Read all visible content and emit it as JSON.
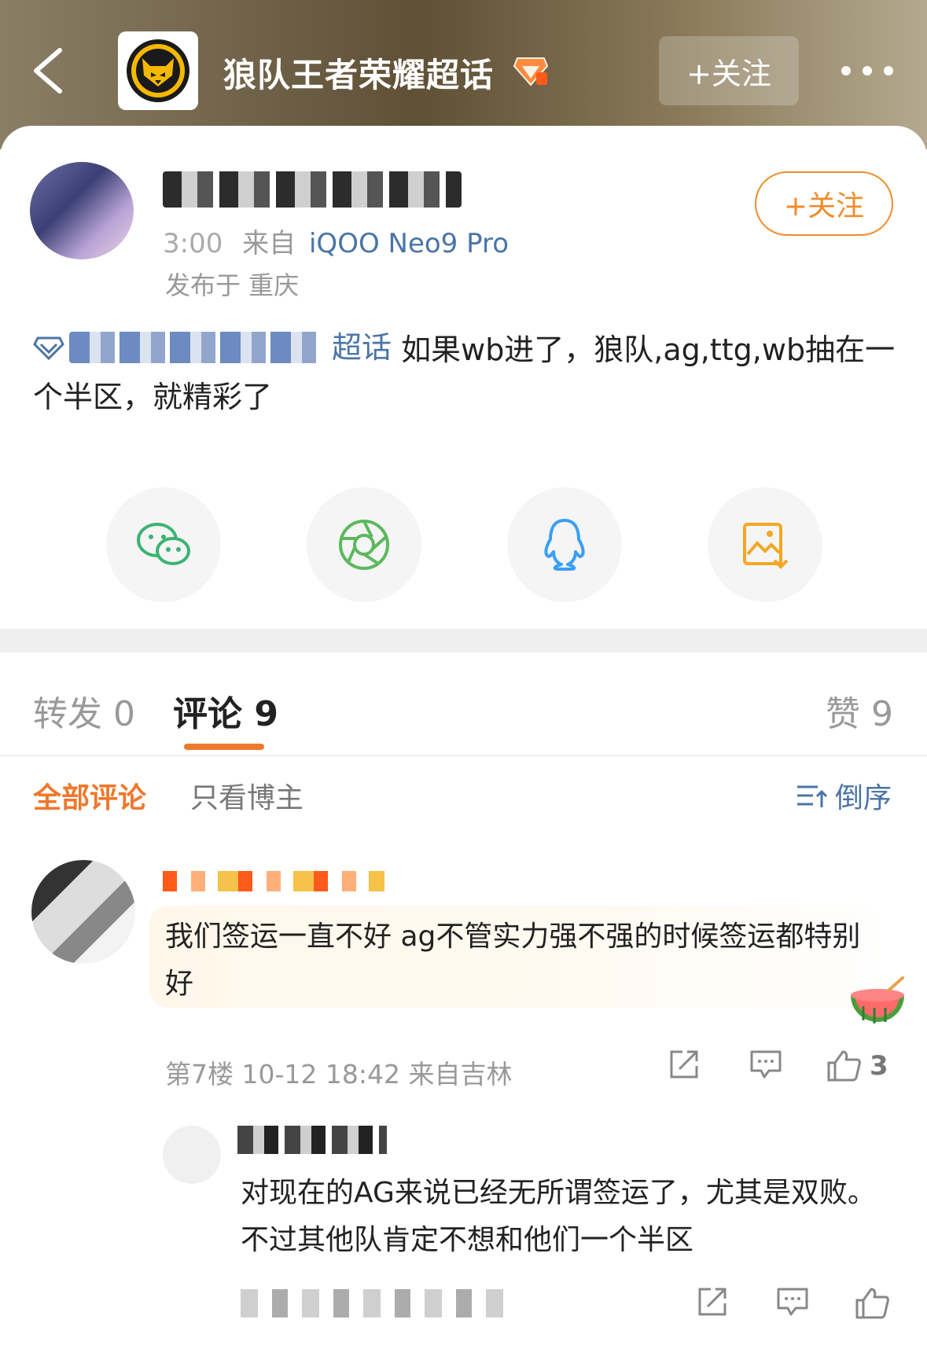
{
  "header": {
    "title": "狼队王者荣耀超话",
    "follow_label": "+关注"
  },
  "post": {
    "time_suffix": "3:00",
    "from_label": "来自",
    "device": "iQOO Neo9 Pro",
    "location": "发布于 重庆",
    "follow_label": "+关注",
    "topic_suffix": "超话",
    "text": "如果wb进了，狼队,ag,ttg,wb抽在一个半区，就精彩了"
  },
  "share": {
    "icons": [
      "wechat-icon",
      "moments-icon",
      "qq-icon",
      "save-image-icon"
    ]
  },
  "tabs": {
    "repost": "转发 0",
    "comments": "评论 9",
    "likes": "赞 9"
  },
  "filters": {
    "all": "全部评论",
    "owner_only": "只看博主",
    "sort": "倒序"
  },
  "comment": {
    "text": "我们签运一直不好 ag不管实力强不强的时候签运都特别好",
    "meta": "第7楼 10-12 18:42 来自吉林",
    "like_count": "3"
  },
  "reply": {
    "text": "对现在的AG来说已经无所谓签运了，尤其是双败。不过其他队肯定不想和他们一个半区"
  },
  "colors": {
    "accent": "#f0782b",
    "link": "#4a74a8",
    "wechat": "#3cb371",
    "moments": "#5cb85c",
    "qq": "#3a9ff5",
    "save": "#f5a623"
  }
}
